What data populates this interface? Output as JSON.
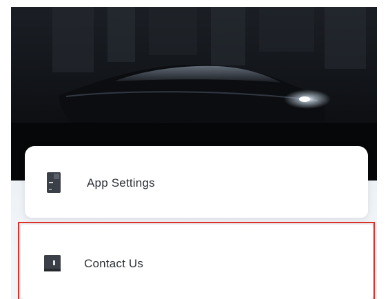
{
  "menu": {
    "items": [
      {
        "label": "App Settings",
        "icon": "settings-page-icon"
      },
      {
        "label": "Contact Us",
        "icon": "contact-book-icon"
      }
    ]
  },
  "colors": {
    "highlight": "#e0302a",
    "hero_dark": "#07080a",
    "panel": "#eef2f6",
    "text": "#2c3036"
  }
}
